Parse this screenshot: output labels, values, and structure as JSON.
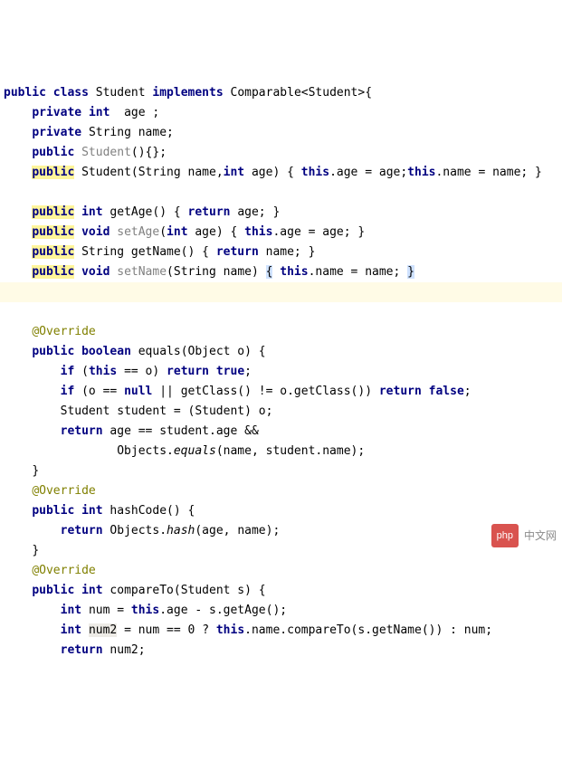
{
  "code": {
    "l01": {
      "a": "public",
      "b": "class",
      "c": "Student",
      "d": "implements",
      "e": "Comparable<Student>{"
    },
    "l02": {
      "a": "private",
      "b": "int",
      "c": "age ;"
    },
    "l03": {
      "a": "private",
      "b": "String name;"
    },
    "l04": {
      "a": "public",
      "b": "Student",
      "c": "(){};"
    },
    "l05": {
      "a": "public",
      "b": "Student(String name,",
      "c": "int",
      "d": "age) {",
      "e": "this",
      "f": ".age = age;",
      "g": "this",
      "h": ".name = name; }"
    },
    "l06": {
      "a": "public",
      "b": "int",
      "c": "getAge() {",
      "d": "return",
      "e": "age; }"
    },
    "l07": {
      "a": "public",
      "b": "void",
      "c": "setAge",
      "d": "(",
      "e": "int",
      "f": "age) {",
      "g": "this",
      "h": ".age = age; }"
    },
    "l08": {
      "a": "public",
      "b": "String getName() {",
      "c": "return",
      "d": "name; }"
    },
    "l09": {
      "a": "public",
      "b": "void",
      "c": "setName",
      "d": "(String name)",
      "e": "{",
      "f": "this",
      "g": ".name = name;",
      "h": "}"
    },
    "ovr": "@Override",
    "l11": {
      "a": "public",
      "b": "boolean",
      "c": "equals(Object o) {"
    },
    "l12": {
      "a": "if",
      "b": "(",
      "c": "this",
      "d": "== o)",
      "e": "return",
      "f": "true",
      "g": ";"
    },
    "l13": {
      "a": "if",
      "b": "(o ==",
      "c": "null",
      "d": "|| getClass() != o.getClass())",
      "e": "return",
      "f": "false",
      "g": ";"
    },
    "l14": "Student student = (Student) o;",
    "l15": {
      "a": "return",
      "b": "age == student.age &&"
    },
    "l16": {
      "a": "Objects.",
      "b": "equals",
      "c": "(name, student.name);"
    },
    "l17": "}",
    "l19": {
      "a": "public",
      "b": "int",
      "c": "hashCode() {"
    },
    "l20": {
      "a": "return",
      "b": "Objects.",
      "c": "hash",
      "d": "(age, name);"
    },
    "l22": {
      "a": "public",
      "b": "int",
      "c": "compareTo(Student s) {"
    },
    "l23": {
      "a": "int",
      "b": "num =",
      "c": "this",
      "d": ".age - s.getAge();"
    },
    "l24": {
      "a": "int",
      "b": "num2",
      "c": "= num ==",
      "d": "0",
      "e": "?",
      "f": "this",
      "g": ".name.compareTo(s.getName()) : num;"
    },
    "l25": {
      "a": "return",
      "b": "num2;"
    }
  },
  "footer": {
    "badge": "php",
    "text": "中文网"
  }
}
